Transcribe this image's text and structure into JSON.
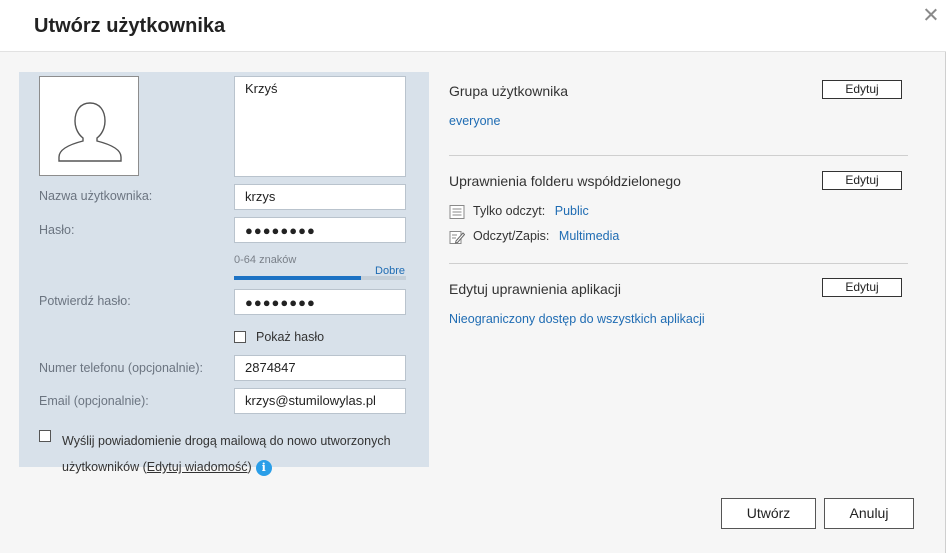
{
  "dialog": {
    "title": "Utwórz użytkownika"
  },
  "form": {
    "description_value": "Krzyś",
    "username_label": "Nazwa użytkownika:",
    "username_value": "krzys",
    "password_label": "Hasło:",
    "password_value": "●●●●●●●●",
    "password_hint": "0-64 znaków",
    "password_strength_label": "Dobre",
    "password_strength_fraction": 0.74,
    "confirm_label": "Potwierdź hasło:",
    "confirm_value": "●●●●●●●●",
    "show_password_label": "Pokaż hasło",
    "phone_label": "Numer telefonu (opcjonalnie):",
    "phone_value": "2874847",
    "email_label": "Email (opcjonalnie):",
    "email_value": "krzys@stumilowylas.pl",
    "notify_text_1": "Wyślij powiadomienie drogą mailową do nowo utworzonych użytkowników (",
    "notify_link": "Edytuj wiadomość",
    "notify_text_2": ")"
  },
  "groups": {
    "title": "Grupa użytkownika",
    "edit_label": "Edytuj",
    "value": "everyone"
  },
  "folders": {
    "title": "Uprawnienia folderu współdzielonego",
    "edit_label": "Edytuj",
    "read_only_label": "Tylko odczyt:",
    "read_only_value": "Public",
    "read_write_label": "Odczyt/Zapis:",
    "read_write_value": "Multimedia"
  },
  "apps": {
    "title": "Edytuj uprawnienia aplikacji",
    "edit_label": "Edytuj",
    "value": "Nieograniczony dostęp do wszystkich aplikacji"
  },
  "footer": {
    "create_label": "Utwórz",
    "cancel_label": "Anuluj"
  },
  "icons": {
    "close": "close-icon",
    "avatar": "user-avatar-icon",
    "read_only": "document-icon",
    "read_write": "edit-document-icon",
    "info": "info-icon"
  },
  "colors": {
    "accent": "#1f6cb3",
    "panel": "#d8e1ea",
    "info": "#2a9ee8"
  }
}
